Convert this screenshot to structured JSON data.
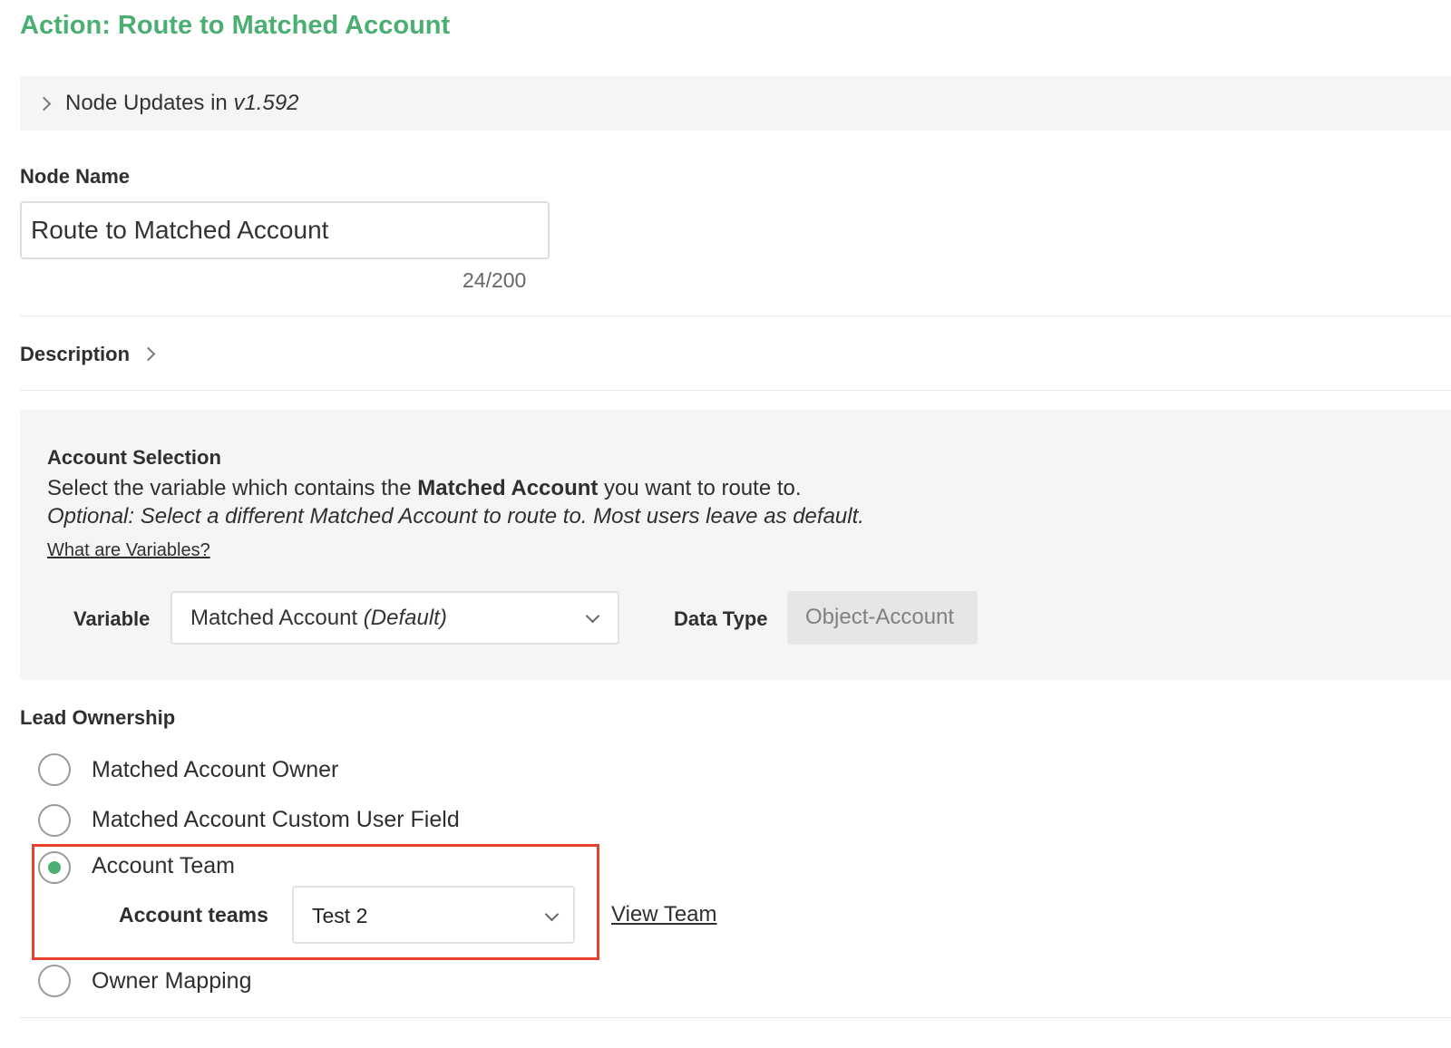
{
  "header": {
    "title": "Action: Route to Matched Account"
  },
  "node_updates": {
    "label": "Node Updates in",
    "version": "v1.592"
  },
  "node_name": {
    "label": "Node Name",
    "value": "Route to Matched Account",
    "counter": "24/200"
  },
  "description": {
    "label": "Description"
  },
  "account_selection": {
    "heading": "Account Selection",
    "line_prefix": "Select the variable which contains the",
    "line_bold": "Matched Account",
    "line_suffix": "you want to route to.",
    "optional_text": "Optional: Select a different Matched Account to route to. Most users leave as default.",
    "variables_link": "What are Variables?",
    "variable_label": "Variable",
    "variable_value": "Matched Account",
    "variable_default": "(Default)",
    "data_type_label": "Data Type",
    "data_type_value": "Object-Account"
  },
  "lead_ownership": {
    "heading": "Lead Ownership",
    "options": [
      {
        "label": "Matched Account Owner",
        "selected": false
      },
      {
        "label": "Matched Account Custom User Field",
        "selected": false
      },
      {
        "label": "Account Team",
        "selected": true
      },
      {
        "label": "Owner Mapping",
        "selected": false
      }
    ],
    "account_teams_label": "Account teams",
    "account_teams_value": "Test 2",
    "view_team_link": "View Team"
  },
  "colors": {
    "accent": "#4caf72",
    "highlight": "#e4402b",
    "panel_bg": "#f5f5f5"
  }
}
